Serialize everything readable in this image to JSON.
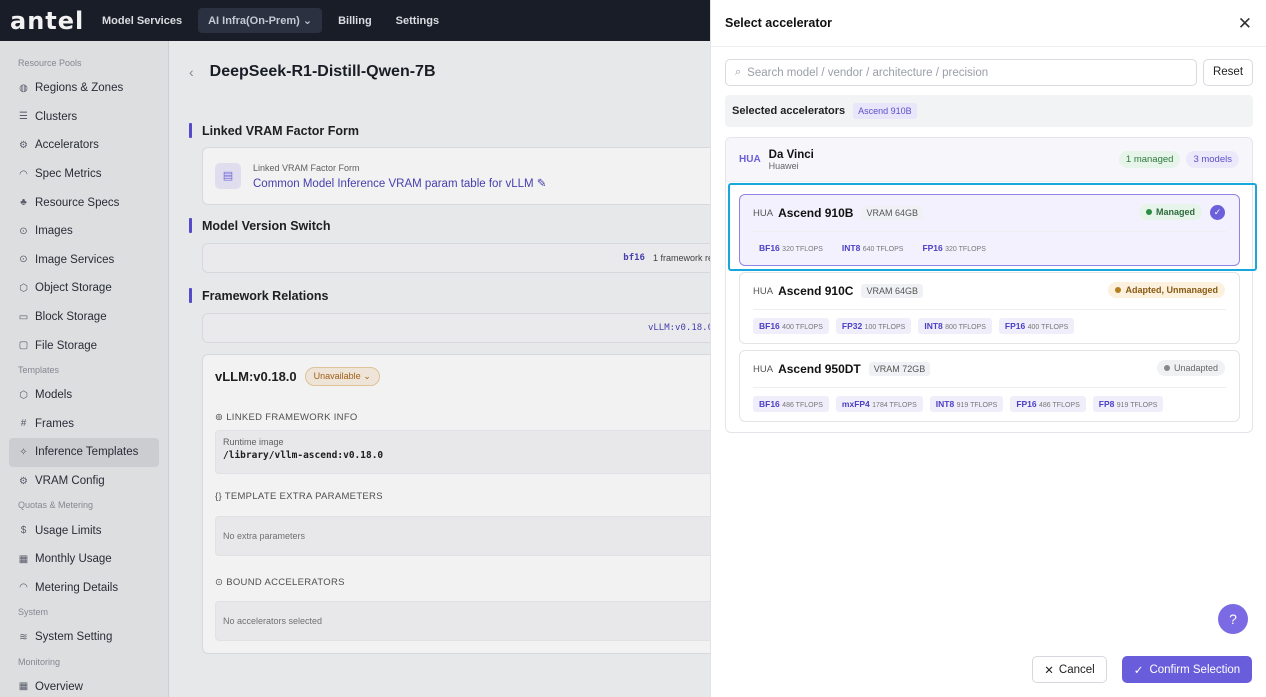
{
  "topbar": {
    "logo": "antel",
    "nav": [
      "Model Services",
      "AI Infra(On-Prem)",
      "Billing",
      "Settings"
    ],
    "nav_active_index": 1
  },
  "sidebar": {
    "groups": [
      {
        "label": "Resource Pools",
        "items": [
          {
            "label": "Regions & Zones",
            "icon": "globe-icon"
          },
          {
            "label": "Clusters",
            "icon": "server-icon"
          },
          {
            "label": "Accelerators",
            "icon": "chip-icon"
          },
          {
            "label": "Spec Metrics",
            "icon": "gauge-icon"
          },
          {
            "label": "Resource Specs",
            "icon": "network-icon"
          },
          {
            "label": "Images",
            "icon": "disc-icon"
          },
          {
            "label": "Image Services",
            "icon": "disc-icon"
          },
          {
            "label": "Object Storage",
            "icon": "box-icon"
          },
          {
            "label": "Block Storage",
            "icon": "drive-icon"
          },
          {
            "label": "File Storage",
            "icon": "folder-icon"
          }
        ]
      },
      {
        "label": "Templates",
        "items": [
          {
            "label": "Models",
            "icon": "box-icon"
          },
          {
            "label": "Frames",
            "icon": "hash-icon"
          },
          {
            "label": "Inference Templates",
            "icon": "sparkle-icon",
            "active": true
          },
          {
            "label": "VRAM Config",
            "icon": "gear-icon"
          }
        ]
      },
      {
        "label": "Quotas & Metering",
        "items": [
          {
            "label": "Usage Limits",
            "icon": "dollar-icon"
          },
          {
            "label": "Monthly Usage",
            "icon": "calendar-icon"
          },
          {
            "label": "Metering Details",
            "icon": "gauge-icon"
          }
        ]
      },
      {
        "label": "System",
        "items": [
          {
            "label": "System Setting",
            "icon": "layers-icon"
          }
        ]
      },
      {
        "label": "Monitoring",
        "items": [
          {
            "label": "Overview",
            "icon": "grid-icon"
          }
        ]
      }
    ]
  },
  "main": {
    "title": "DeepSeek-R1-Distill-Qwen-7B",
    "sections": {
      "vram": "Linked VRAM Factor Form",
      "version": "Model Version Switch",
      "framework": "Framework Relations"
    },
    "vram_card": {
      "small": "Linked VRAM Factor Form",
      "link": "Common Model Inference VRAM param table for vLLM"
    },
    "version_strip": {
      "tag": "bf16",
      "text": "1 framework re"
    },
    "framework_strip": "vLLM:v0.18.0",
    "framework_card": {
      "name": "vLLM:v0.18.0",
      "badge": "Unavailable",
      "linked_label": "LINKED FRAMEWORK INFO",
      "runtime_label": "Runtime image",
      "runtime_value": "/library/vllm-ascend:v0.18.0",
      "extra_label": "TEMPLATE EXTRA PARAMETERS",
      "extra_value": "No extra parameters",
      "bound_label": "BOUND ACCELERATORS",
      "bound_value": "No accelerators selected"
    }
  },
  "drawer": {
    "title": "Select accelerator",
    "search_placeholder": "Search model / vendor / architecture / precision",
    "reset": "Reset",
    "selected_label": "Selected accelerators",
    "selected_chip": "Ascend 910B",
    "vendor": {
      "tag": "HUA",
      "name": "Da Vinci",
      "sub": "Huawei",
      "managed": "1 managed",
      "models": "3 models"
    },
    "accelerators": [
      {
        "tag": "HUA",
        "name": "Ascend 910B",
        "vram": "VRAM 64GB",
        "status": "Managed",
        "status_kind": "managed",
        "selected": true,
        "precisions": [
          {
            "p": "BF16",
            "v": "320 TFLOPS"
          },
          {
            "p": "INT8",
            "v": "640 TFLOPS"
          },
          {
            "p": "FP16",
            "v": "320 TFLOPS"
          }
        ]
      },
      {
        "tag": "HUA",
        "name": "Ascend 910C",
        "vram": "VRAM 64GB",
        "status": "Adapted, Unmanaged",
        "status_kind": "adapted",
        "selected": false,
        "precisions": [
          {
            "p": "BF16",
            "v": "400 TFLOPS"
          },
          {
            "p": "FP32",
            "v": "100 TFLOPS"
          },
          {
            "p": "INT8",
            "v": "800 TFLOPS"
          },
          {
            "p": "FP16",
            "v": "400 TFLOPS"
          }
        ]
      },
      {
        "tag": "HUA",
        "name": "Ascend 950DT",
        "vram": "VRAM 72GB",
        "status": "Unadapted",
        "status_kind": "unadapt",
        "selected": false,
        "precisions": [
          {
            "p": "BF16",
            "v": "486 TFLOPS"
          },
          {
            "p": "mxFP4",
            "v": "1784 TFLOPS"
          },
          {
            "p": "INT8",
            "v": "919 TFLOPS"
          },
          {
            "p": "FP16",
            "v": "486 TFLOPS"
          },
          {
            "p": "FP8",
            "v": "919 TFLOPS"
          }
        ]
      }
    ],
    "cancel": "Cancel",
    "confirm": "Confirm Selection"
  }
}
